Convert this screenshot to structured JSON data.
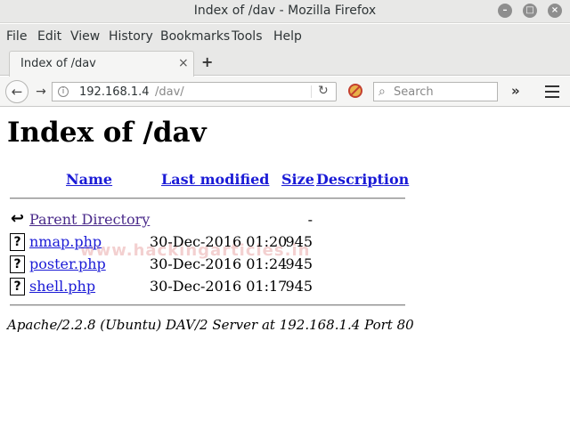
{
  "window": {
    "title": "Index of /dav - Mozilla Firefox"
  },
  "menu": [
    "File",
    "Edit",
    "View",
    "History",
    "Bookmarks",
    "Tools",
    "Help"
  ],
  "tab": {
    "label": "Index of /dav",
    "close": "×",
    "new_tab": "+"
  },
  "navbar": {
    "url_host": "192.168.1.4",
    "url_path": "/dav/",
    "search_placeholder": "Search",
    "overflow": "»"
  },
  "page": {
    "heading": "Index of /dav",
    "columns": {
      "name": "Name",
      "modified": "Last modified",
      "size": "Size",
      "description": "Description"
    },
    "rows": [
      {
        "name": "Parent Directory",
        "modified": "",
        "size": "-",
        "icon": "back-arrow-icon"
      },
      {
        "name": "nmap.php",
        "modified": "30-Dec-2016 01:20",
        "size": "945",
        "icon": "unknown-file-icon"
      },
      {
        "name": "poster.php",
        "modified": "30-Dec-2016 01:24",
        "size": "945",
        "icon": "unknown-file-icon"
      },
      {
        "name": "shell.php",
        "modified": "30-Dec-2016 01:17",
        "size": "945",
        "icon": "unknown-file-icon"
      }
    ],
    "footer": "Apache/2.2.8 (Ubuntu) DAV/2 Server at 192.168.1.4 Port 80",
    "watermark": "www.hackingarticles.in"
  },
  "colors": {
    "link": "#1b1bd6",
    "visited_link": "#4a2a8a",
    "chrome": "#e8e8e7"
  }
}
